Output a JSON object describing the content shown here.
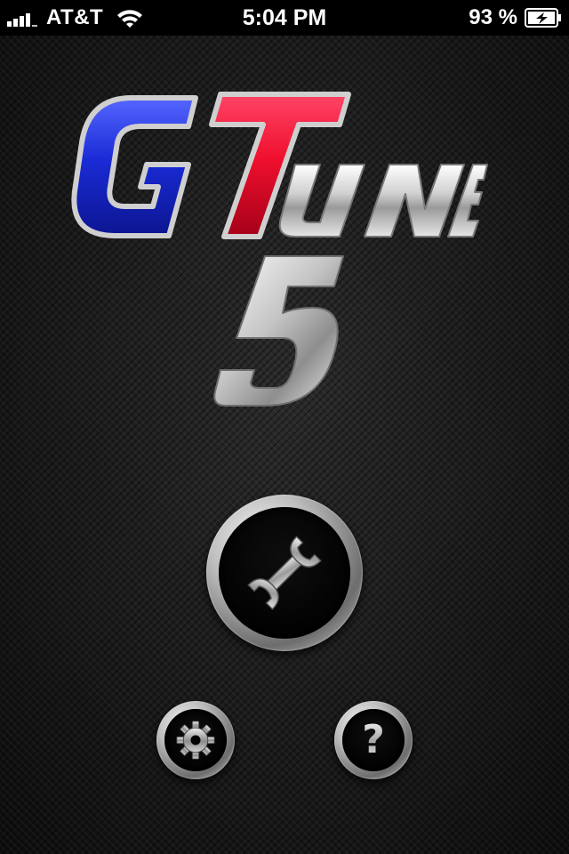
{
  "status_bar": {
    "carrier": "AT&T",
    "time": "5:04 PM",
    "battery_percent": "93 %",
    "signal_bars": 4,
    "charging": true
  },
  "logo": {
    "brand_g": "G",
    "brand_t": "T",
    "brand_une": "UNE",
    "version": "5",
    "colors": {
      "g": "#2233cc",
      "t": "#ee1133",
      "chrome": "#d8d8d8"
    }
  },
  "buttons": {
    "tune_icon": "wrench-icon",
    "settings_icon": "gear-icon",
    "help_glyph": "?",
    "help_icon": "question-mark-icon"
  }
}
